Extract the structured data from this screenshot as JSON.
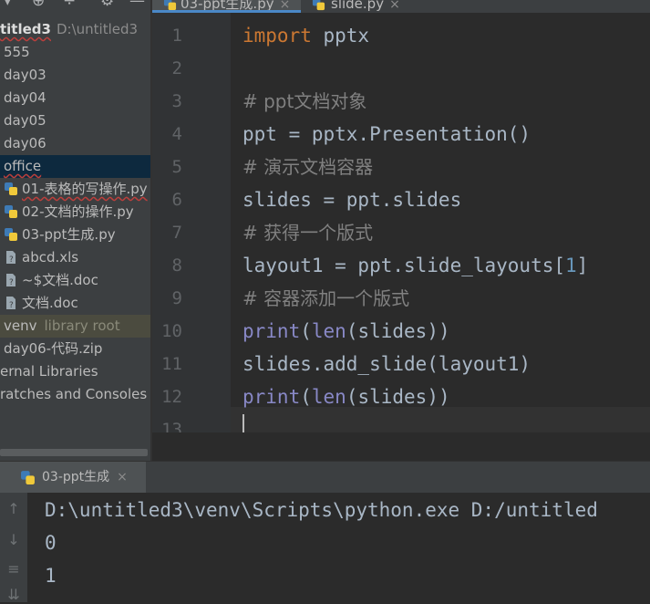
{
  "project": {
    "root_name": "titled3",
    "root_path": "D:\\untitled3",
    "items": [
      {
        "label": "555"
      },
      {
        "label": "day03"
      },
      {
        "label": "day04"
      },
      {
        "label": "day05"
      },
      {
        "label": "day06"
      },
      {
        "label": "office"
      },
      {
        "label": "01-表格的写操作.py"
      },
      {
        "label": "02-文档的操作.py"
      },
      {
        "label": "03-ppt生成.py"
      },
      {
        "label": "abcd.xls"
      },
      {
        "label": "~$文档.doc"
      },
      {
        "label": "文档.doc"
      },
      {
        "label": "venv",
        "hint": "library root"
      },
      {
        "label": "day06-代码.zip"
      },
      {
        "label": "ernal Libraries"
      },
      {
        "label": "ratches and Consoles"
      }
    ]
  },
  "tabs": [
    {
      "label": "03-ppt生成.py",
      "active": true
    },
    {
      "label": "slide.py",
      "active": false
    }
  ],
  "editor": {
    "line_numbers": [
      "1",
      "2",
      "3",
      "4",
      "5",
      "6",
      "7",
      "8",
      "9",
      "10",
      "11",
      "12",
      "13"
    ],
    "lines": [
      {
        "kw": "import",
        "rest": " pptx"
      },
      {
        "text": ""
      },
      {
        "comment": "# ppt文档对象"
      },
      {
        "text": "ppt = pptx.Presentation()"
      },
      {
        "comment": "# 演示文档容器"
      },
      {
        "text": "slides = ppt.slides"
      },
      {
        "comment": "# 获得一个版式"
      },
      {
        "pre": "layout1 = ppt.slide_layouts[",
        "num": "1",
        "post": "]"
      },
      {
        "comment": "# 容器添加一个版式"
      },
      {
        "bi1": "print",
        "p1": "(",
        "bi2": "len",
        "p2": "(slides))"
      },
      {
        "text": "slides.add_slide(layout1)"
      },
      {
        "bi1": "print",
        "p1": "(",
        "bi2": "len",
        "p2": "(slides))"
      },
      {
        "text": ""
      }
    ]
  },
  "run": {
    "tab_label": "03-ppt生成",
    "output": [
      "D:\\untitled3\\venv\\Scripts\\python.exe D:/untitled",
      "0",
      "1"
    ]
  }
}
